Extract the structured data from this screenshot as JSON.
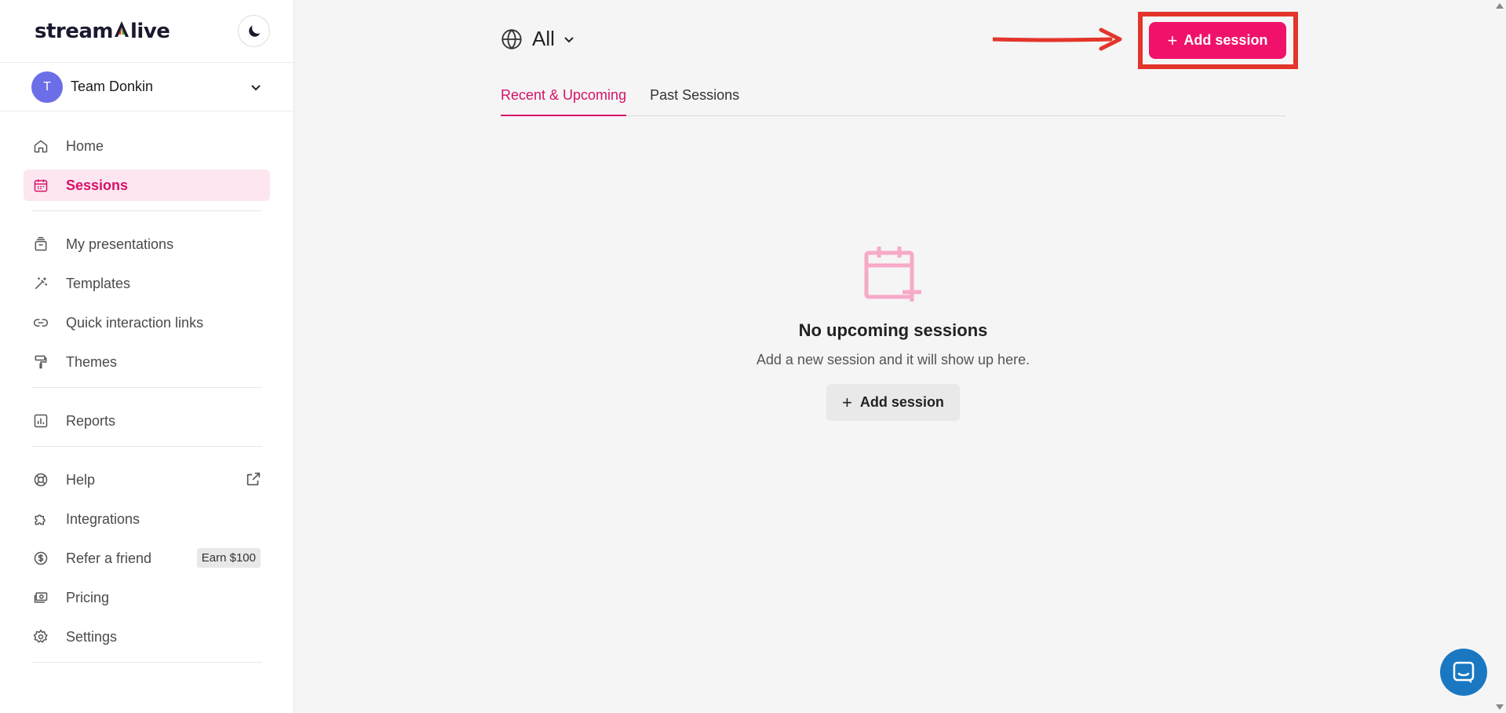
{
  "brand": {
    "logo_prefix": "stream",
    "logo_suffix": "live"
  },
  "team": {
    "initial": "T",
    "name": "Team Donkin"
  },
  "nav": {
    "home": "Home",
    "sessions": "Sessions",
    "my_presentations": "My presentations",
    "templates": "Templates",
    "quick_links": "Quick interaction links",
    "themes": "Themes",
    "reports": "Reports",
    "help": "Help",
    "integrations": "Integrations",
    "refer": "Refer a friend",
    "refer_badge": "Earn $100",
    "pricing": "Pricing",
    "settings": "Settings"
  },
  "header": {
    "filter_label": "All",
    "add_session_label": "Add session"
  },
  "tabs": {
    "recent": "Recent & Upcoming",
    "past": "Past Sessions"
  },
  "empty": {
    "title": "No upcoming sessions",
    "subtitle": "Add a new session and it will show up here.",
    "button_label": "Add session"
  },
  "colors": {
    "accent": "#f0126a",
    "accent_text": "#d6126a",
    "annotation": "#e3352b",
    "chat": "#1a78c2"
  }
}
